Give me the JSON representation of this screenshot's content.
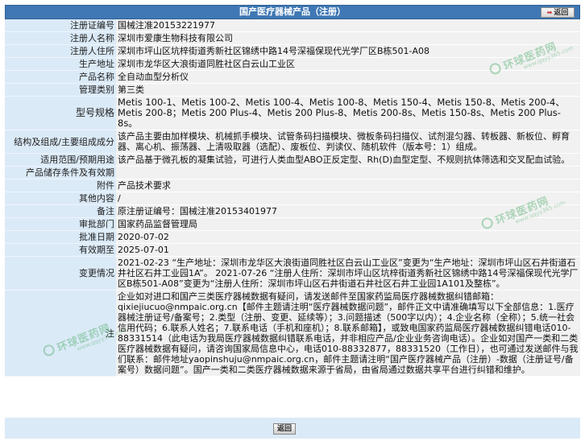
{
  "header": {
    "title": "国产医疗器械产品（注册）",
    "back_label": "返回"
  },
  "fields": [
    {
      "label": "注册证编号",
      "value": "国械注准20153221977"
    },
    {
      "label": "注册人名称",
      "value": "深圳市爱康生物科技有限公司"
    },
    {
      "label": "注册人住所",
      "value": "深圳市坪山区坑梓街道秀新社区锦绣中路14号深福保现代光学厂区B栋501-A08"
    },
    {
      "label": "生产地址",
      "value": "深圳市龙华区大浪街道同胜社区白云山工业区"
    },
    {
      "label": "产品名称",
      "value": "全自动血型分析仪"
    },
    {
      "label": "管理类别",
      "value": "第三类"
    },
    {
      "label": "型号规格",
      "value": "Metis 100-1、Metis 100-2、Metis 100-4、Metis 100-8、Metis 150-4、Metis 150-8、Metis 200-4、Metis 200-8；Metis 200 Plus-4、Metis 200 Plus-8、Metis 200-8s、Metis 150-8s、Metis 200 Plus-8s。"
    },
    {
      "label": "结构及组成/主要组成成分",
      "value": "该产品主要由加样模块、机械抓手模块、试管条码扫描模块、微板条码扫描仪、试剂混匀器、转板器、新板位、孵育器、离心机、振荡器、上清吸取器（选配）、废板位、判读仪、随机软件（版本号：1）组成。"
    },
    {
      "label": "适用范围/预期用途",
      "value": "该产品基于微孔板的凝集试验，可进行人类血型ABO正反定型、Rh(D)血型定型、不规则抗体筛选和交叉配血试验。"
    },
    {
      "label": "产品储存条件及有效期",
      "value": ""
    },
    {
      "label": "附件",
      "value": "产品技术要求"
    },
    {
      "label": "其他内容",
      "value": "/"
    },
    {
      "label": "备注",
      "value": "原注册证编号：国械注准20153401977"
    },
    {
      "label": "审批部门",
      "value": "国家药品监督管理局"
    },
    {
      "label": "批准日期",
      "value": "2020-07-02"
    },
    {
      "label": "有效期至",
      "value": "2025-07-01"
    },
    {
      "label": "变更情况",
      "value": "2021-02-23 “生产地址：深圳市龙华区大浪街道同胜社区白云山工业区”变更为“生产地址：深圳市坪山区石井街道石井社区石井工业园1A”。 2021-07-26 “注册人住所：深圳市坪山区坑梓街道秀新社区锦绣中路14号深福保现代光学厂区B栋501-A08”变更为“注册人住所：深圳市坪山区石井街道石井社区石井工业园1A101及整栋”。"
    },
    {
      "label": "注",
      "value": "企业如对进口和国产三类医疗器械数据有疑问，请发送邮件至国家药监局医疗器械数据纠错邮箱：qixiejiucuo@nmpaic.org.cn【邮件主题请注明“医疗器械数据问题”，邮件正文中请准确填写以下全部信息：1.医疗器械注册证号/备案号；2.类型（注册、变更、延续等）；3.问题描述（500字以内）；4.企业名称（全称）；5.统一社会信用代码；6.联系人姓名；7.联系电话（手机和座机）；8.联系邮箱】，或致电国家药监局医疗器械数据纠错电话010-88331514（此电话为我局医疗器械数据纠错联系电话，并非相应产品/企业业务咨询电话）。企业如对国产一类和二类医疗器械数据有疑问，请咨询国家局信息中心，电话010-88332877，88331520（工作日），也可通过发送邮件与我们联系：邮件地址yaopinshuju@nmpaic.org.cn，邮件主题请注明“国产医疗器械产品（注册）-数据（注册证号/备案号）数据问题”。国产一类和二类医疗器械数据来源于省局，由省局通过数据共享平台进行纠错和维护。"
    }
  ],
  "watermarks": [
    {
      "main": "环球医药网",
      "sub": "www.qqyy365.com"
    },
    {
      "main": "环球医药网",
      "sub": "www.qqyy365.com"
    },
    {
      "main": "环球医药网",
      "sub": "www.qqyy365.com"
    }
  ],
  "footer": {
    "back_label": "返回"
  },
  "colors": {
    "header_bg": "#3f78b4",
    "label_bg": "#dbeaf7",
    "value_bg": "#f1f1f1"
  }
}
